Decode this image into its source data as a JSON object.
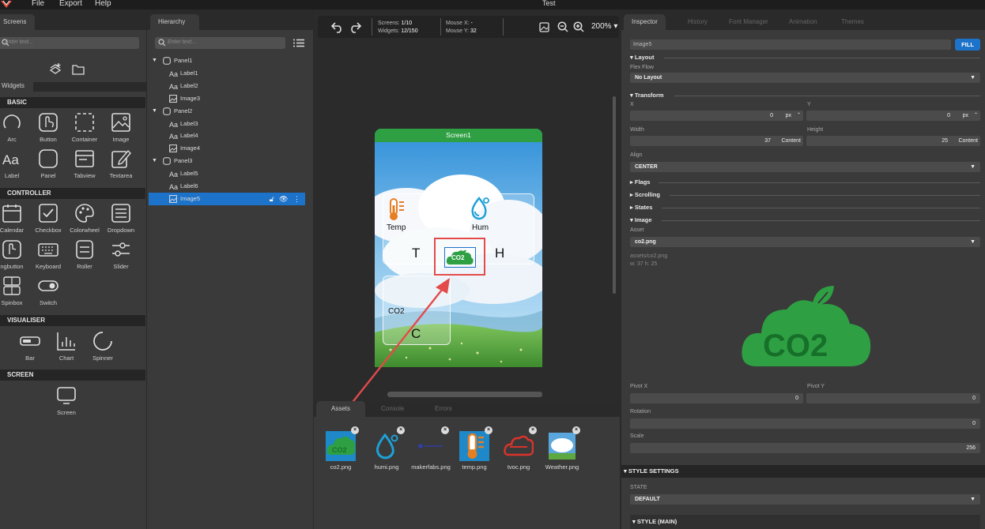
{
  "menu": {
    "file": "File",
    "export": "Export",
    "help": "Help",
    "title": "Test"
  },
  "screens_panel": {
    "tab": "Screens",
    "search_placeholder": "Enter text...",
    "widgets_tab": "Widgets"
  },
  "widgets": {
    "basic_title": "BASIC",
    "basic": [
      "Arc",
      "Button",
      "Container",
      "Image",
      "Label",
      "Panel",
      "Tabview",
      "Textarea"
    ],
    "controller_title": "CONTROLLER",
    "controller": [
      "Calendar",
      "Checkbox",
      "Colorwheel",
      "Dropdown",
      "ngbutton",
      "Keyboard",
      "Roller",
      "Slider",
      "Spinbox",
      "Switch"
    ],
    "visualiser_title": "VISUALISER",
    "visualiser": [
      "Bar",
      "Chart",
      "Spinner"
    ],
    "screen_title": "SCREEN",
    "screen": [
      "Screen"
    ]
  },
  "hierarchy": {
    "tab": "Hierarchy",
    "search_placeholder": "Enter text...",
    "items": [
      {
        "label": "Panel1",
        "type": "panel"
      },
      {
        "label": "Label1",
        "type": "label"
      },
      {
        "label": "Label2",
        "type": "label"
      },
      {
        "label": "Image3",
        "type": "image"
      },
      {
        "label": "Panel2",
        "type": "panel"
      },
      {
        "label": "Label3",
        "type": "label"
      },
      {
        "label": "Label4",
        "type": "label"
      },
      {
        "label": "Image4",
        "type": "image"
      },
      {
        "label": "Panel3",
        "type": "panel"
      },
      {
        "label": "Label5",
        "type": "label"
      },
      {
        "label": "Label6",
        "type": "label"
      },
      {
        "label": "Image5",
        "type": "image",
        "selected": true
      }
    ]
  },
  "canvas": {
    "screens_label": "Screens:",
    "screens_value": "1/10",
    "widgets_label": "Widgets:",
    "widgets_value": "12/150",
    "mouse_x_label": "Mouse X:",
    "mouse_x_value": "-",
    "mouse_y_label": "Mouse Y:",
    "mouse_y_value": "32",
    "zoom": "200%",
    "screen_title": "Screen1",
    "temp_label": "Temp",
    "hum_label": "Hum",
    "t_label": "T",
    "h_label": "H",
    "co2_label": "CO2",
    "c_label": "C",
    "image_text": "CO2"
  },
  "bottom_tabs": {
    "assets": "Assets",
    "console": "Console",
    "errors": "Errors"
  },
  "assets": [
    "co2.png",
    "humi.png",
    "makerfabs.png",
    "temp.png",
    "tvoc.png",
    "Weather.png"
  ],
  "inspector": {
    "tabs": [
      "Inspector",
      "History",
      "Font Manager",
      "Animation",
      "Themes"
    ],
    "name": "Image5",
    "fill_button": "FILL",
    "layout_title": "Layout",
    "flex_flow_label": "Flex Flow",
    "flex_flow_value": "No Layout",
    "transform_title": "Transform",
    "x_label": "X",
    "x_value": "0",
    "x_unit": "px",
    "y_label": "Y",
    "y_value": "0",
    "y_unit": "px",
    "width_label": "Width",
    "width_value": "37",
    "width_unit": "Content",
    "height_label": "Height",
    "height_value": "25",
    "height_unit": "Content",
    "align_label": "Align",
    "align_value": "CENTER",
    "flags_title": "Flags",
    "scrolling_title": "Scrolling",
    "states_title": "States",
    "image_title": "Image",
    "asset_label": "Asset",
    "asset_value": "co2.png",
    "asset_path": "assets/co2.png",
    "asset_size": "w: 37  h: 25",
    "preview_text": "CO2",
    "pivot_x_label": "Pivot X",
    "pivot_x_value": "0",
    "pivot_y_label": "Pivot Y",
    "pivot_y_value": "0",
    "rotation_label": "Rotation",
    "rotation_value": "0",
    "scale_label": "Scale",
    "scale_value": "256",
    "style_settings_title": "STYLE SETTINGS",
    "state_label": "STATE",
    "state_value": "DEFAULT",
    "style_main_title": "STYLE (MAIN)"
  },
  "colors": {
    "accent": "#1d72c9",
    "green": "#2ea043",
    "highlight": "#e34a4a"
  }
}
